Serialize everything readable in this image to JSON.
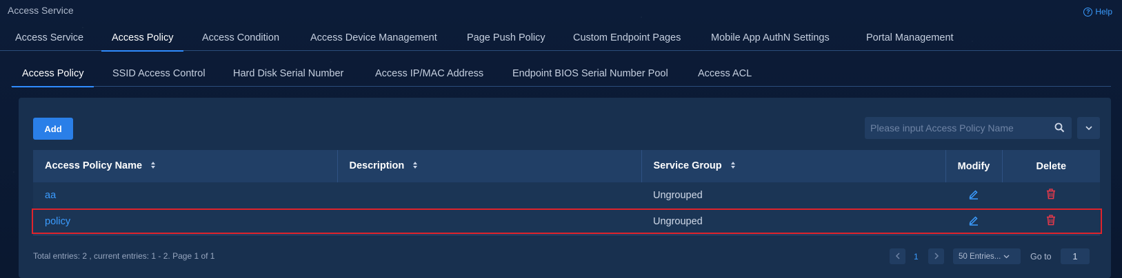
{
  "header": {
    "title": "Access Service",
    "help_label": "Help",
    "help_icon_glyph": "?"
  },
  "main_tabs": [
    {
      "label": "Access Service",
      "active": false
    },
    {
      "label": "Access Policy",
      "active": true
    },
    {
      "label": "Access Condition",
      "active": false
    },
    {
      "label": "Access Device Management",
      "active": false
    },
    {
      "label": "Page Push Policy",
      "active": false
    },
    {
      "label": "Custom Endpoint Pages",
      "active": false
    },
    {
      "label": "Mobile App AuthN Settings",
      "active": false
    },
    {
      "label": "Portal Management",
      "active": false
    }
  ],
  "sub_tabs": [
    {
      "label": "Access Policy",
      "active": true
    },
    {
      "label": "SSID Access Control",
      "active": false
    },
    {
      "label": "Hard Disk Serial Number",
      "active": false
    },
    {
      "label": "Access IP/MAC Address",
      "active": false
    },
    {
      "label": "Endpoint BIOS Serial Number Pool",
      "active": false
    },
    {
      "label": "Access ACL",
      "active": false
    }
  ],
  "toolbar": {
    "add_label": "Add",
    "search_placeholder": "Please input Access Policy Name"
  },
  "table": {
    "columns": [
      "Access Policy Name",
      "Description",
      "Service Group",
      "Modify",
      "Delete"
    ],
    "rows": [
      {
        "name": "aa",
        "description": "",
        "service_group": "Ungrouped"
      },
      {
        "name": "policy",
        "description": "",
        "service_group": "Ungrouped"
      }
    ]
  },
  "footer": {
    "summary": "Total entries: 2 , current entries: 1 - 2. Page 1 of 1",
    "current_page": "1",
    "page_size": "50 Entries...",
    "goto_label": "Go to",
    "goto_value": "1"
  },
  "colors": {
    "accent": "#2f8cff",
    "link": "#3b9cff",
    "delete": "#e8394a",
    "highlight": "#e0242c"
  }
}
